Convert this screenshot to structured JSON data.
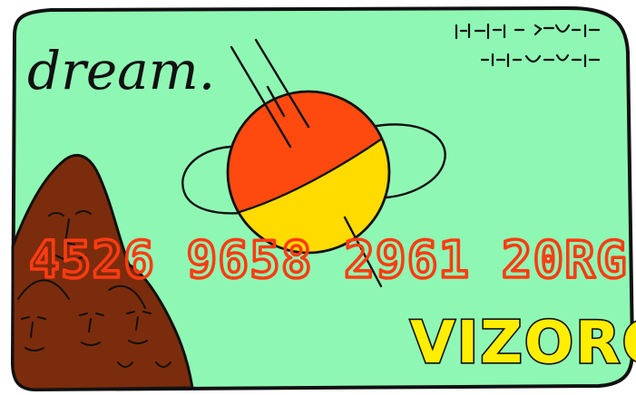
{
  "card": {
    "brand": "dream.",
    "number": "4526 9658 2961 20RG",
    "issuer": "VIZORG"
  },
  "colors": {
    "card_background": "#8ff7b4",
    "outline": "#111111",
    "planet_top": "#ff4a0f",
    "planet_bottom": "#ffdb00",
    "number": "#ff3b12",
    "issuer_fill": "#ffee00",
    "mountain": "#7b2c0c"
  },
  "icons": {
    "planet": "ringed-planet-icon",
    "mountain": "mountain-faces-icon",
    "scribble": "scribble-text-icon"
  }
}
